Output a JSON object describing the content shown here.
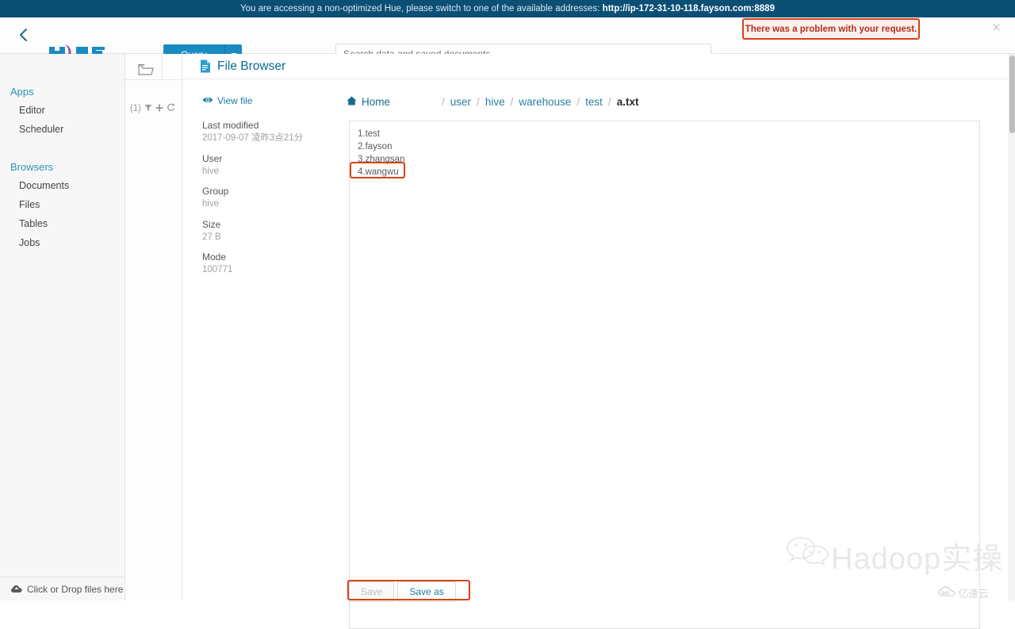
{
  "banner": {
    "message": "You are accessing a non-optimized Hue, please switch to one of the available addresses:",
    "address": "http://ip-172-31-10-118.fayson.com:8889"
  },
  "navbar": {
    "back_icon": "chevron-left-icon",
    "logo_text": "Hue",
    "query_label": "Query",
    "query_caret_icon": "caret-down-icon",
    "search_placeholder": "Search data and saved documents...",
    "search_value": ""
  },
  "alert": {
    "message": "There was a problem with your request.",
    "close_label": "×",
    "border_color": "#d84315",
    "text_color": "#b4301c",
    "background_color": "#fdf0ee"
  },
  "sidebar": {
    "groups": [
      {
        "label": "Apps",
        "items": [
          "Editor",
          "Scheduler"
        ]
      },
      {
        "label": "Browsers",
        "items": [
          "Documents",
          "Files",
          "Tables",
          "Jobs"
        ]
      }
    ],
    "uploader_label": "Click or Drop files here",
    "uploader_icon": "cloud-upload-icon"
  },
  "assist": {
    "folder_icon": "folder-open-icon",
    "count_label": "(1)",
    "filter_icon": "filter-icon",
    "add_icon": "plus-icon",
    "refresh_icon": "refresh-icon"
  },
  "page": {
    "title": "File Browser",
    "title_icon": "file-document-icon"
  },
  "metadata": {
    "view_file_label": "View file",
    "view_file_icon": "eye-icon",
    "fields": [
      {
        "label": "Last modified",
        "value": "2017-09-07 凌昨3点21分"
      },
      {
        "label": "User",
        "value": "hive"
      },
      {
        "label": "Group",
        "value": "hive"
      },
      {
        "label": "Size",
        "value": "27 B"
      },
      {
        "label": "Mode",
        "value": "100771"
      }
    ]
  },
  "breadcrumb": {
    "home_label": "Home",
    "home_icon": "home-icon",
    "separator": "/",
    "segments": [
      {
        "label": "user",
        "current": false
      },
      {
        "label": "hive",
        "current": false
      },
      {
        "label": "warehouse",
        "current": false
      },
      {
        "label": "test",
        "current": false
      },
      {
        "label": "a.txt",
        "current": true
      }
    ]
  },
  "file_content": {
    "lines": [
      "1.test",
      "2.fayson",
      "3.zhangsan",
      "4.wangwu"
    ],
    "highlighted_line_index": 3
  },
  "footer": {
    "save_label": "Save",
    "save_disabled": true,
    "save_as_label": "Save as"
  },
  "watermarks": {
    "hadoop": "Hadoop实操",
    "hadoop_icon": "wechat-icon",
    "yisuyun": "亿速云",
    "yisuyun_icon": "cloud-icon"
  },
  "colors": {
    "banner_bg": "#0b4f75",
    "primary": "#1a8bc0",
    "link": "#1a7fa8",
    "highlight": "#d84315",
    "sidebar_bg": "#f7f7f7"
  }
}
